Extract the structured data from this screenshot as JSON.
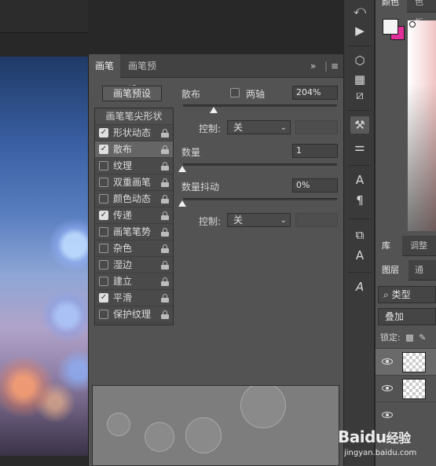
{
  "brush_panel": {
    "tabs": [
      {
        "label": "画笔",
        "active": true
      },
      {
        "label": "画笔预设",
        "active": false
      }
    ],
    "collapse_glyph": "»",
    "menu_glyph": "≡",
    "preset_button": "画笔预设",
    "list_header": "画笔笔尖形状",
    "options": [
      {
        "label": "形状动态",
        "checked": true
      },
      {
        "label": "散布",
        "checked": true,
        "selected": true
      },
      {
        "label": "纹理",
        "checked": false
      },
      {
        "label": "双重画笔",
        "checked": false
      },
      {
        "label": "颜色动态",
        "checked": false
      },
      {
        "label": "传递",
        "checked": true
      },
      {
        "label": "画笔笔势",
        "checked": false
      },
      {
        "label": "杂色",
        "checked": false
      },
      {
        "label": "湿边",
        "checked": false
      },
      {
        "label": "建立",
        "checked": false
      },
      {
        "label": "平滑",
        "checked": true
      },
      {
        "label": "保护纹理",
        "checked": false
      }
    ],
    "scatter": {
      "label": "散布",
      "both_axes_label": "两轴",
      "both_axes_checked": false,
      "value": "204%",
      "control_label": "控制:",
      "control_value": "关"
    },
    "count": {
      "label": "数量",
      "value": "1"
    },
    "count_jitter": {
      "label": "数量抖动",
      "value": "0%",
      "control_label": "控制:",
      "control_value": "关"
    }
  },
  "right_column": {
    "top_tabs": [
      "颜色",
      "色板"
    ],
    "mid_tabs": [
      "库",
      "调整"
    ],
    "layer_tabs": [
      "图层",
      "通道"
    ],
    "search_label": "类型",
    "blend_mode": "叠加",
    "lock_label": "锁定:"
  },
  "watermark": {
    "brand": "Baidu",
    "suffix": "经验",
    "url": "jingyan.baidu.com"
  },
  "colors": {
    "foreground": "#f4f4f4",
    "background": "#e1309c",
    "panel": "#535353"
  }
}
